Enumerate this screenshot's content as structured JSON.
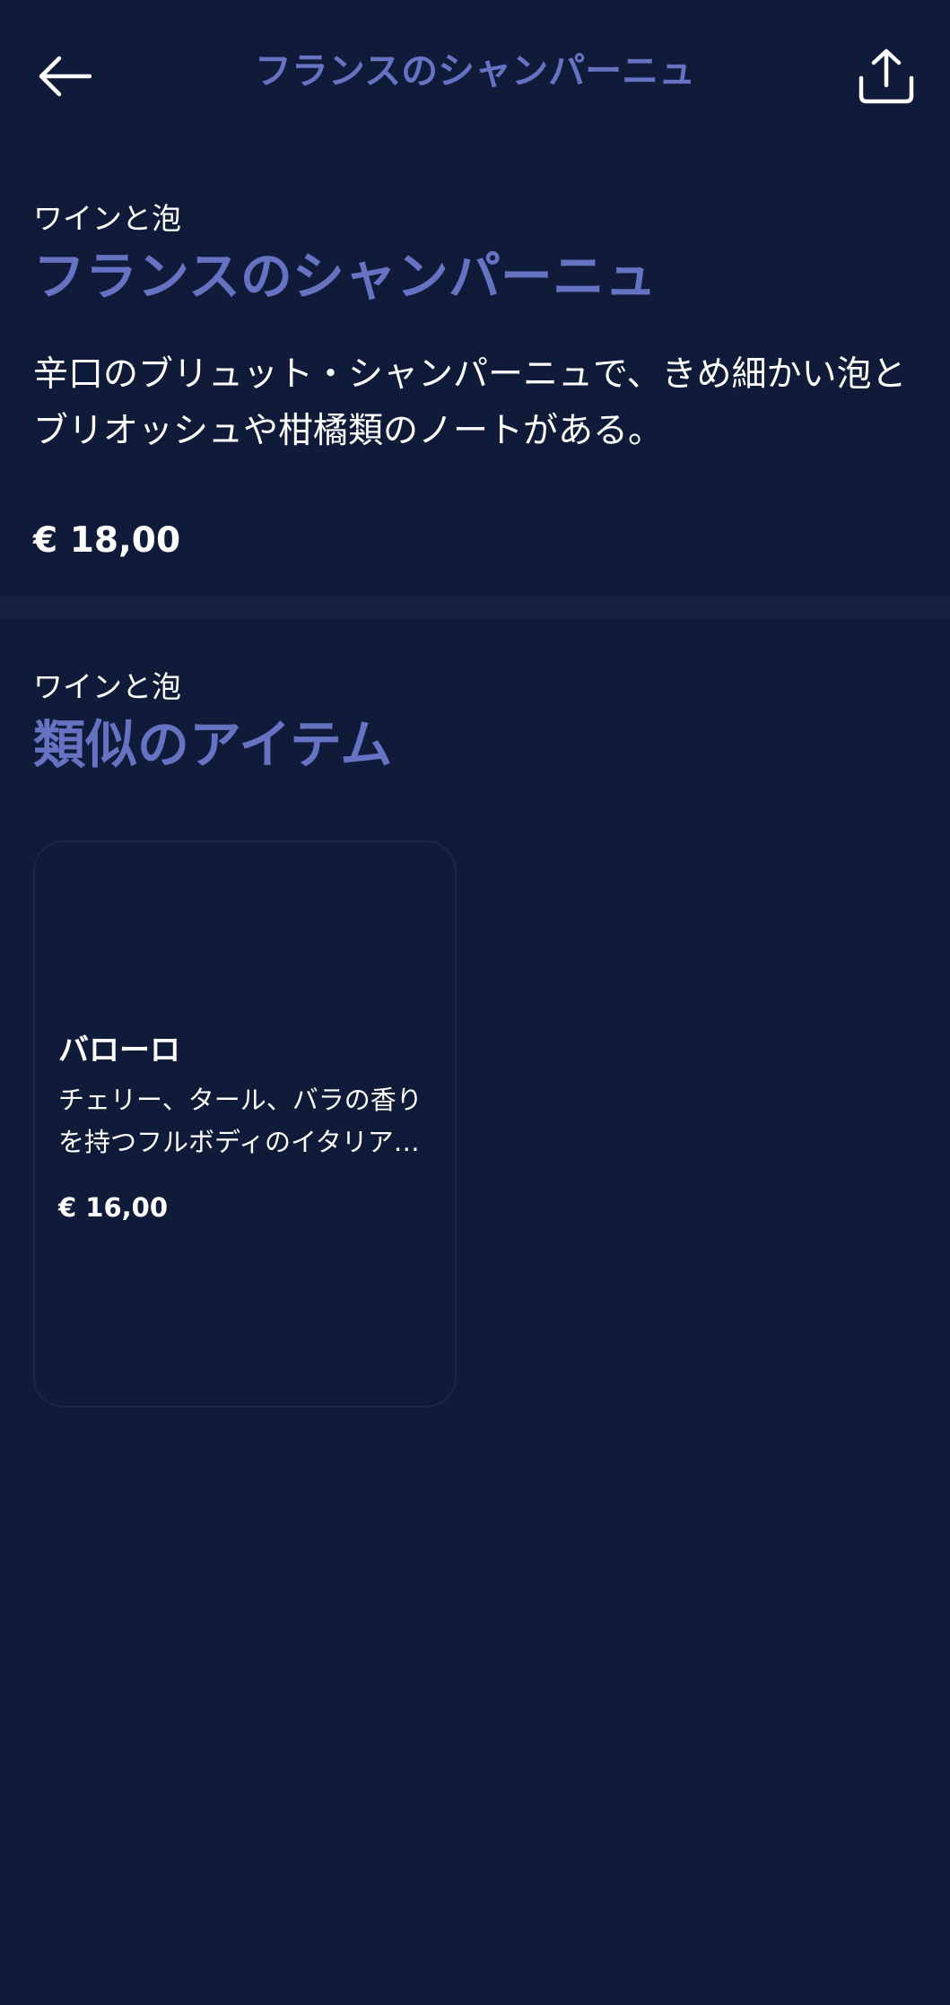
{
  "nav": {
    "title": "フランスのシャンパーニュ"
  },
  "product": {
    "category": "ワインと泡",
    "title": "フランスのシャンパーニュ",
    "description": "辛口のブリュット・シャンパーニュで、きめ細かい泡とブリオッシュや柑橘類のノートがある。",
    "price": "€ 18,00"
  },
  "similar": {
    "category": "ワインと泡",
    "heading": "類似のアイテム",
    "items": [
      {
        "title": "バローロ",
        "description": "チェリー、タール、バラの香りを持つフルボディのイタリア…",
        "price": "€ 16,00"
      }
    ]
  },
  "colors": {
    "background": "#101b3a",
    "accent": "#6672c2",
    "divider": "#16213f",
    "text": "#ffffff"
  },
  "icons": {
    "back": "arrow-left-icon",
    "share": "share-icon"
  }
}
